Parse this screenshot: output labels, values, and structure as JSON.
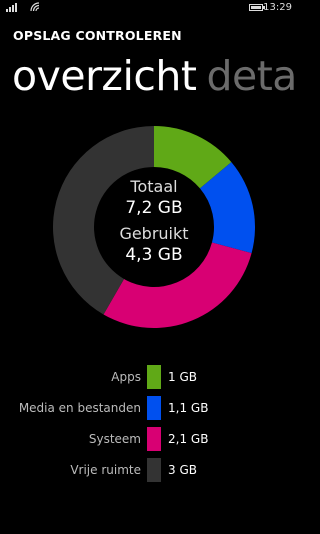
{
  "status_bar": {
    "time": "13:29",
    "battery_level": 1.0,
    "icons": [
      "signal-icon",
      "wifi-icon",
      "battery-icon"
    ]
  },
  "header": {
    "app_title": "OPSLAG CONTROLEREN",
    "pivot_active": "overzicht",
    "pivot_next": "detai"
  },
  "summary": {
    "total_label": "Totaal",
    "total_value": "7,2 GB",
    "used_label": "Gebruikt",
    "used_value": "4,3 GB"
  },
  "legend": [
    {
      "label": "Apps",
      "value": "1 GB",
      "color": "#60a917"
    },
    {
      "label": "Media en bestanden",
      "value": "1,1 GB",
      "color": "#0050ef"
    },
    {
      "label": "Systeem",
      "value": "2,1 GB",
      "color": "#d80073"
    },
    {
      "label": "Vrije ruimte",
      "value": "3 GB",
      "color": "#333333"
    }
  ],
  "chart_data": {
    "type": "pie",
    "categories": [
      "Apps",
      "Media en bestanden",
      "Systeem",
      "Vrije ruimte"
    ],
    "values": [
      1,
      1.1,
      2.1,
      3
    ],
    "unit": "GB",
    "colors": [
      "#60a917",
      "#0050ef",
      "#d80073",
      "#333333"
    ]
  }
}
